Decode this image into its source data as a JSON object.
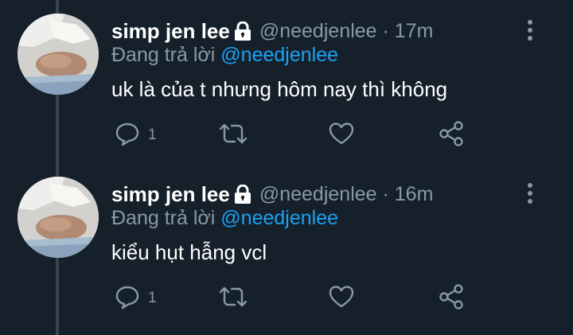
{
  "tweets": [
    {
      "display_name": "simp jen lee",
      "handle": "@needjenlee",
      "time": "17m",
      "reply_prefix": "Đang trả lời ",
      "reply_to": "@needjenlee",
      "text": "uk là của t nhưng hôm nay thì không",
      "reply_count": "1"
    },
    {
      "display_name": "simp jen lee",
      "handle": "@needjenlee",
      "time": "16m",
      "reply_prefix": "Đang trả lời ",
      "reply_to": "@needjenlee",
      "text": "kiểu hụt hẫng vcl",
      "reply_count": "1"
    }
  ],
  "colors": {
    "background": "#15202b",
    "muted": "#8899a6",
    "mention": "#1da1f2",
    "thread_line": "#38444d"
  },
  "icons": [
    "lock-icon",
    "more-vertical-icon",
    "reply-icon",
    "retweet-icon",
    "like-icon",
    "share-icon"
  ]
}
